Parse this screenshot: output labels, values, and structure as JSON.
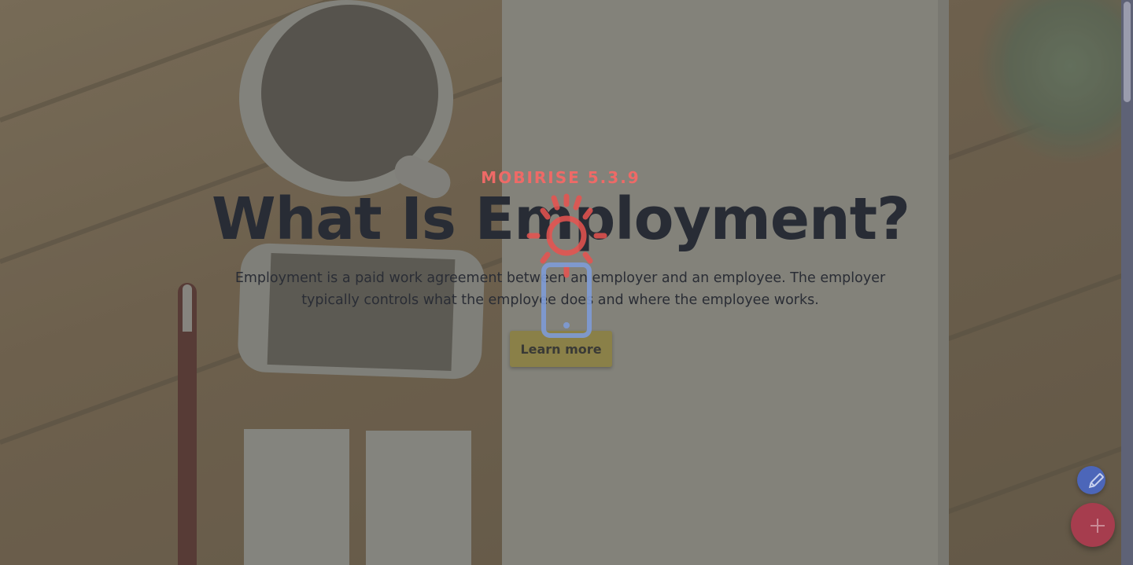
{
  "hero": {
    "brand": "MOBIRISE  5.3.9",
    "title": "What Is Employment?",
    "description": "Employment is a paid work agreement between an employer and an employee. The employer typically controls what the employee does and where the employee works.",
    "button_label": "Learn more"
  },
  "loader": {
    "icon": "sun-phone-loading-icon",
    "sun_color": "#e8534f",
    "phone_color": "#7e9bd6"
  },
  "floating_buttons": {
    "edit_icon": "pencil-icon",
    "add_icon": "plus-icon",
    "edit_color": "#4c66b9",
    "add_color": "#a63d4e"
  }
}
